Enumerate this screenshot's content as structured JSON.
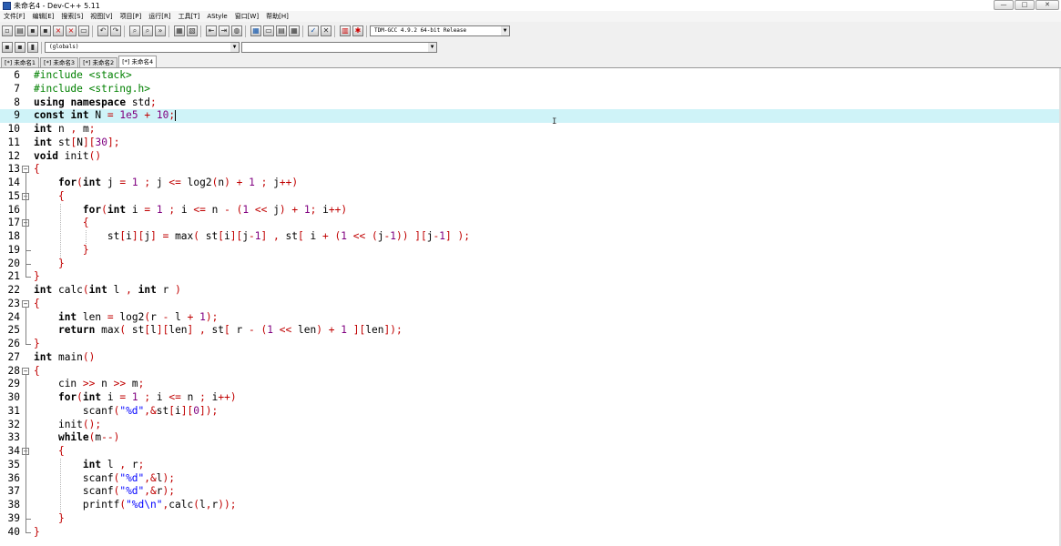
{
  "window": {
    "title": "未命名4 - Dev-C++ 5.11",
    "buttons": [
      "—",
      "□",
      "✕"
    ]
  },
  "menu": [
    "文件[F]",
    "编辑[E]",
    "搜索[S]",
    "视图[V]",
    "项目[P]",
    "运行[R]",
    "工具[T]",
    "AStyle",
    "窗口[W]",
    "帮助[H]"
  ],
  "toolbar": {
    "compiler": "TDM-GCC 4.9.2 64-bit Release",
    "scope": "(globals)",
    "symbol": ""
  },
  "tabs": [
    "[*] 未命名1",
    "[*] 未命名3",
    "[*] 未命名2",
    "[*] 未命名4"
  ],
  "active_tab": 3,
  "editor": {
    "current_line": 9,
    "lines": [
      {
        "n": "6",
        "t": "#include <stack>"
      },
      {
        "n": "7",
        "t": "#include <string.h>"
      },
      {
        "n": "8",
        "t": "using namespace std;"
      },
      {
        "n": "9",
        "t": "const int N = 1e5 + 10;"
      },
      {
        "n": "10",
        "t": "int n , m;"
      },
      {
        "n": "11",
        "t": "int st[N][30];"
      },
      {
        "n": "12",
        "t": "void init()"
      },
      {
        "n": "13",
        "t": "{"
      },
      {
        "n": "14",
        "t": "    for(int j = 1 ; j <= log2(n) + 1 ; j++)"
      },
      {
        "n": "15",
        "t": "    {"
      },
      {
        "n": "16",
        "t": "        for(int i = 1 ; i <= n - (1 << j) + 1; i++)"
      },
      {
        "n": "17",
        "t": "        {"
      },
      {
        "n": "18",
        "t": "            st[i][j] = max( st[i][j-1] , st[ i + (1 << (j-1)) ][j-1] );"
      },
      {
        "n": "19",
        "t": "        }"
      },
      {
        "n": "20",
        "t": "    }"
      },
      {
        "n": "21",
        "t": "}"
      },
      {
        "n": "22",
        "t": "int calc(int l , int r )"
      },
      {
        "n": "23",
        "t": "{"
      },
      {
        "n": "24",
        "t": "    int len = log2(r - l + 1);"
      },
      {
        "n": "25",
        "t": "    return max( st[l][len] , st[ r - (1 << len) + 1 ][len]);"
      },
      {
        "n": "26",
        "t": "}"
      },
      {
        "n": "27",
        "t": "int main()"
      },
      {
        "n": "28",
        "t": "{"
      },
      {
        "n": "29",
        "t": "    cin >> n >> m;"
      },
      {
        "n": "30",
        "t": "    for(int i = 1 ; i <= n ; i++)"
      },
      {
        "n": "31",
        "t": "        scanf(\"%d\",&st[i][0]);"
      },
      {
        "n": "32",
        "t": "    init();"
      },
      {
        "n": "33",
        "t": "    while(m--)"
      },
      {
        "n": "34",
        "t": "    {"
      },
      {
        "n": "35",
        "t": "        int l , r;"
      },
      {
        "n": "36",
        "t": "        scanf(\"%d\",&l);"
      },
      {
        "n": "37",
        "t": "        scanf(\"%d\",&r);"
      },
      {
        "n": "38",
        "t": "        printf(\"%d\\n\",calc(l,r));"
      },
      {
        "n": "39",
        "t": "    }"
      },
      {
        "n": "40",
        "t": "}"
      }
    ]
  },
  "colors": {
    "preprocessor": "#008000",
    "number": "#800080",
    "string": "#0000ff",
    "symbol": "#c00000",
    "current_line": "#cff3f8"
  }
}
